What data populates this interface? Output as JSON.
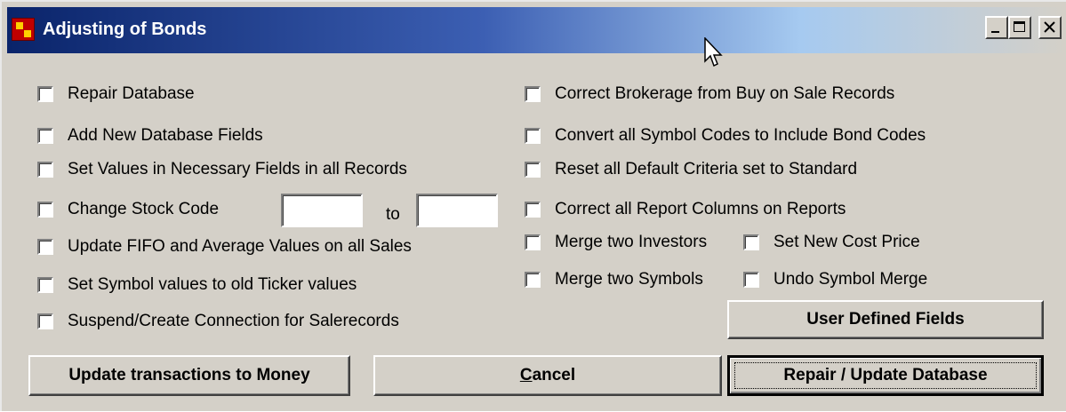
{
  "window": {
    "title": "Adjusting of Bonds",
    "controls": [
      "minimize-icon",
      "maximize-icon",
      "close-icon"
    ]
  },
  "left_options": [
    {
      "label": "Repair Database",
      "checked": false
    },
    {
      "label": "Add New Database Fields",
      "checked": false
    },
    {
      "label": "Set Values in Necessary Fields in all Records",
      "checked": false
    },
    {
      "label": "Change Stock Code",
      "checked": false
    },
    {
      "label": "Update FIFO and Average Values on all Sales",
      "checked": false
    },
    {
      "label": "Set Symbol values to old Ticker values",
      "checked": false
    },
    {
      "label": "Suspend/Create Connection for Salerecords",
      "checked": false
    }
  ],
  "stock_code": {
    "from_value": "",
    "to_label": "to",
    "to_value": ""
  },
  "right_options": [
    {
      "label": "Correct Brokerage from Buy on Sale Records",
      "checked": false
    },
    {
      "label": "Convert all Symbol Codes to Include Bond Codes",
      "checked": false
    },
    {
      "label": "Reset all Default Criteria set to Standard",
      "checked": false
    },
    {
      "label": "Correct all Report Columns on Reports",
      "checked": false
    },
    {
      "label": "Merge two Investors",
      "checked": false
    },
    {
      "label": "Merge two Symbols",
      "checked": false
    }
  ],
  "extra_options": [
    {
      "label": "Set New Cost Price",
      "checked": false
    },
    {
      "label": "Undo Symbol Merge",
      "checked": false
    }
  ],
  "buttons": {
    "user_defined_fields": "User Defined Fields",
    "update_money": "Update transactions to Money",
    "cancel_mnemonic": "C",
    "cancel_rest": "ancel",
    "repair_update": "Repair / Update Database"
  }
}
